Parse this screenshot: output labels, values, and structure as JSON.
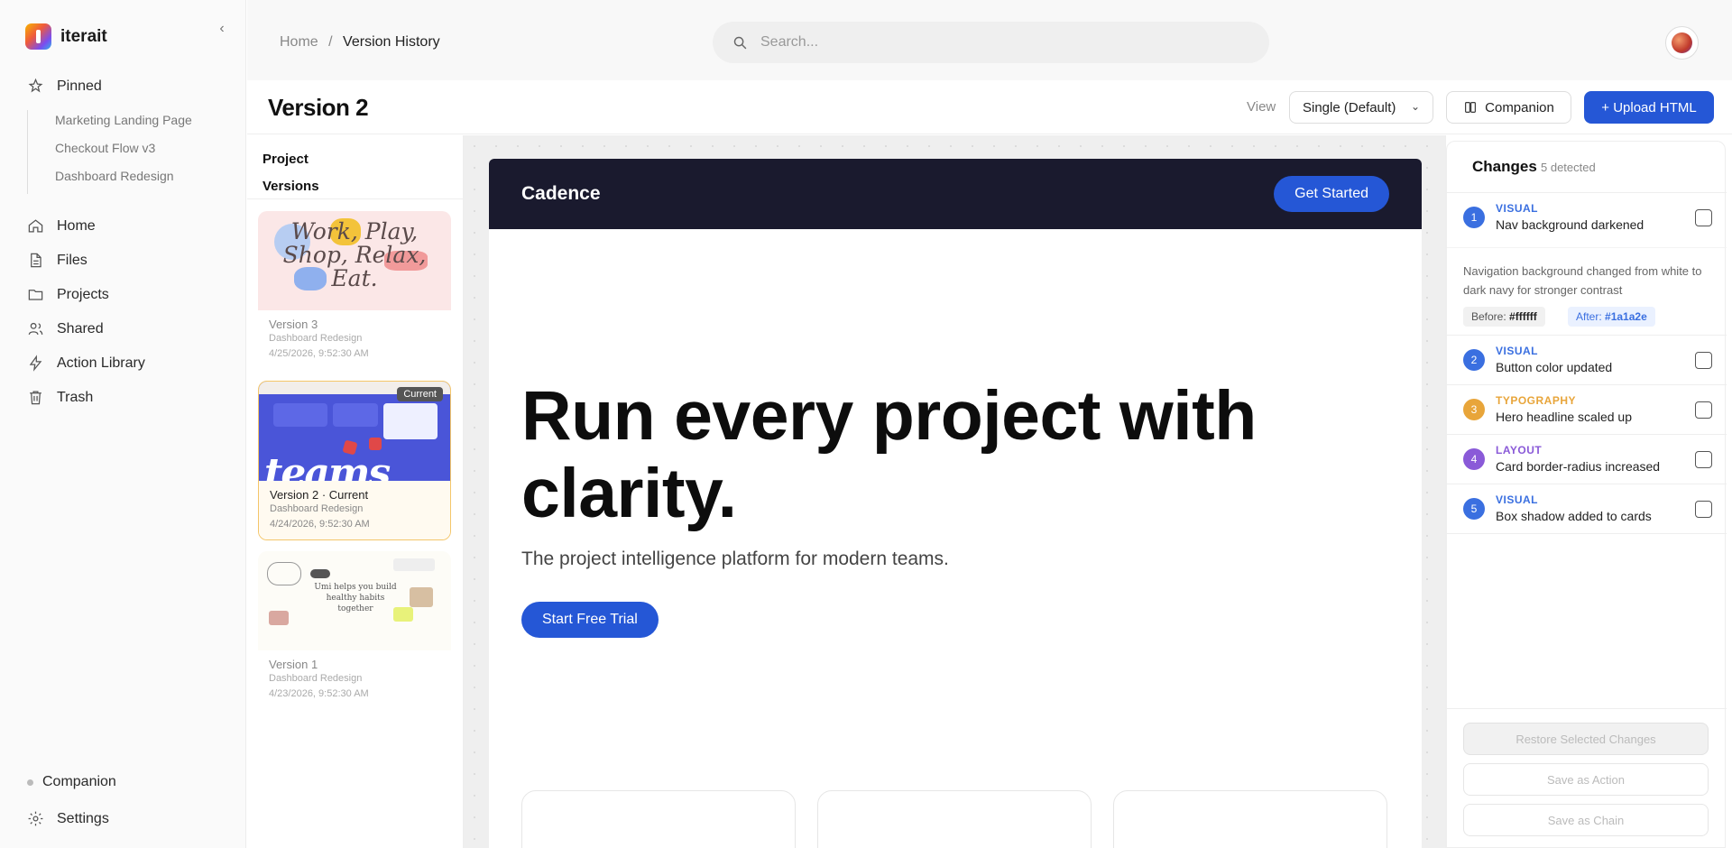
{
  "app": {
    "name": "iterait"
  },
  "sidebar": {
    "pinned_label": "Pinned",
    "pinned_items": [
      "Marketing Landing Page",
      "Checkout Flow v3",
      "Dashboard Redesign"
    ],
    "nav": {
      "home": "Home",
      "files": "Files",
      "projects": "Projects",
      "shared": "Shared",
      "action_library": "Action Library",
      "trash": "Trash"
    },
    "bottom": {
      "companion": "Companion",
      "settings": "Settings"
    }
  },
  "header": {
    "breadcrumb": {
      "home": "Home",
      "separator": "/",
      "current": "Version History"
    },
    "search_placeholder": "Search..."
  },
  "title_row": {
    "title": "Version 2",
    "view_label": "View",
    "view_value": "Single (Default)",
    "companion_button": "Companion",
    "upload_button": "+ Upload HTML"
  },
  "versions": {
    "heading_line1": "Project",
    "heading_line2": "Versions",
    "items": [
      {
        "name": "Version 3",
        "project": "Dashboard Redesign",
        "date": "4/25/2026, 9:52:30 AM",
        "thumb_text": "Work, Play, Shop, Relax, Eat."
      },
      {
        "name": "Version 2 · Current",
        "project": "Dashboard Redesign",
        "date": "4/24/2026, 9:52:30 AM",
        "badge": "Current"
      },
      {
        "name": "Version 1",
        "project": "Dashboard Redesign",
        "date": "4/23/2026, 9:52:30 AM",
        "thumb_text": "Umi helps you build healthy habits together"
      }
    ]
  },
  "preview": {
    "brand": "Cadence",
    "nav_cta": "Get Started",
    "headline": "Run every project with clarity.",
    "subhead": "The project intelligence platform for modern teams.",
    "cta": "Start Free Trial"
  },
  "changes": {
    "heading": "Changes",
    "count": "5 detected",
    "items": [
      {
        "num": "1",
        "category": "VISUAL",
        "title": "Nav background darkened",
        "color": "#3a6fe0"
      },
      {
        "num": "2",
        "category": "VISUAL",
        "title": "Button color updated",
        "color": "#3a6fe0"
      },
      {
        "num": "3",
        "category": "TYPOGRAPHY",
        "title": "Hero headline scaled up",
        "color": "#e8a53a"
      },
      {
        "num": "4",
        "category": "LAYOUT",
        "title": "Card border-radius increased",
        "color": "#8a5ad8"
      },
      {
        "num": "5",
        "category": "VISUAL",
        "title": "Box shadow added to cards",
        "color": "#3a6fe0"
      }
    ],
    "detail": {
      "description": "Navigation background changed from white to dark navy for stronger contrast",
      "before_label": "Before:",
      "before_value": "#ffffff",
      "after_label": "After:",
      "after_value": "#1a1a2e"
    },
    "actions": {
      "restore": "Restore Selected Changes",
      "save_action": "Save as Action",
      "save_chain": "Save as Chain"
    }
  },
  "colors": {
    "accent": "#2557d6",
    "nav_dark": "#1a1a2e"
  }
}
